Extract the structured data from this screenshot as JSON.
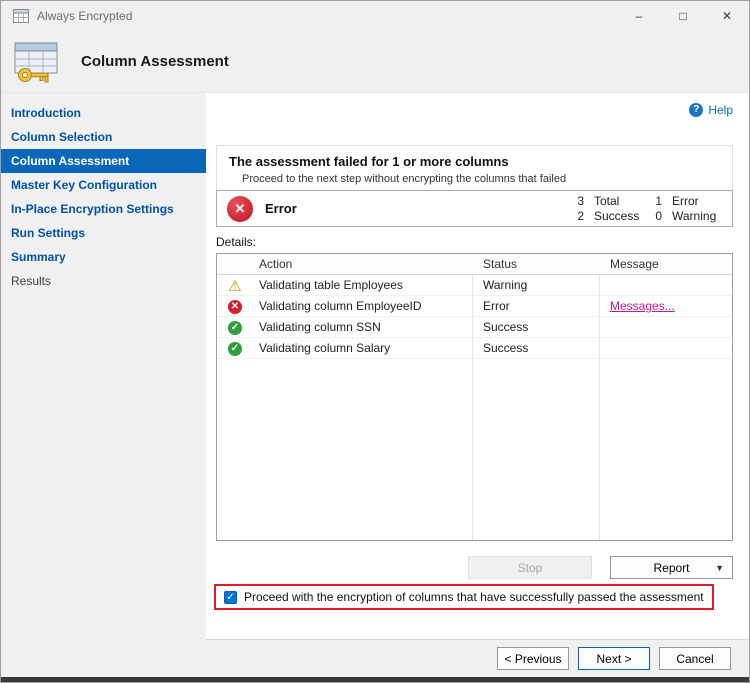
{
  "window": {
    "title": "Always Encrypted",
    "controls": {
      "minimize": "–",
      "maximize": "□",
      "close": "✕"
    }
  },
  "icons": {
    "success": "✓",
    "error": "✕",
    "warning": "⚠",
    "help": "?",
    "check": "✓",
    "chevron_down": "▼"
  },
  "colors": {
    "accent_blue": "#0b68b8",
    "link_blue": "#0051a8",
    "error_red": "#d41f2c",
    "success_green": "#2e9e3f",
    "warning_yellow": "#c89200",
    "annotation_red": "#e31b23",
    "message_link": "#c2188f"
  },
  "header": {
    "title": "Column Assessment"
  },
  "sidebar": {
    "items": [
      {
        "label": "Introduction",
        "state": "link"
      },
      {
        "label": "Column Selection",
        "state": "link"
      },
      {
        "label": "Column Assessment",
        "state": "active"
      },
      {
        "label": "Master Key Configuration",
        "state": "link"
      },
      {
        "label": "In-Place Encryption Settings",
        "state": "link"
      },
      {
        "label": "Run Settings",
        "state": "link"
      },
      {
        "label": "Summary",
        "state": "link"
      },
      {
        "label": "Results",
        "state": "disabled"
      }
    ]
  },
  "main": {
    "help_label": "Help",
    "banner": {
      "title": "The assessment failed for 1 or more columns",
      "subtitle": "Proceed to the next step without encrypting the columns that failed"
    },
    "status": {
      "label": "Error",
      "stats": {
        "total": {
          "value": "3",
          "label": "Total"
        },
        "error": {
          "value": "1",
          "label": "Error"
        },
        "success": {
          "value": "2",
          "label": "Success"
        },
        "warning": {
          "value": "0",
          "label": "Warning"
        }
      }
    },
    "details_label": "Details:",
    "table": {
      "headers": [
        "Action",
        "Status",
        "Message"
      ],
      "rows": [
        {
          "icon": "warning",
          "action": "Validating table Employees",
          "status": "Warning",
          "message": ""
        },
        {
          "icon": "error",
          "action": "Validating column EmployeeID",
          "status": "Error",
          "message": "Messages..."
        },
        {
          "icon": "success",
          "action": "Validating column SSN",
          "status": "Success",
          "message": ""
        },
        {
          "icon": "success",
          "action": "Validating column Salary",
          "status": "Success",
          "message": ""
        }
      ]
    },
    "buttons": {
      "stop": "Stop",
      "report": "Report"
    },
    "checkbox": {
      "checked": true,
      "label": "Proceed with the encryption of columns that have successfully passed the assessment"
    }
  },
  "footer": {
    "previous": "< Previous",
    "next": "Next >",
    "cancel": "Cancel"
  }
}
